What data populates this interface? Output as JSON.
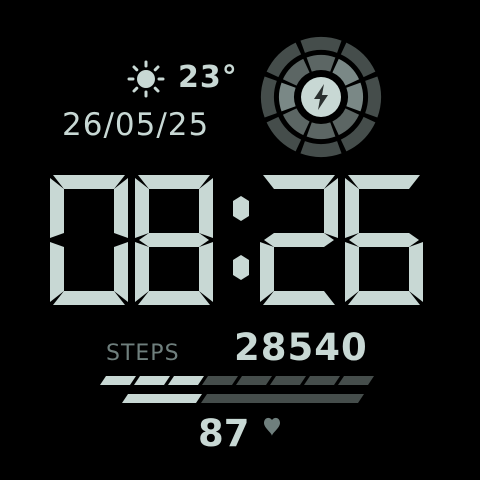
{
  "weather": {
    "temperature": "23°",
    "icon": "sun-icon"
  },
  "date": {
    "text": "26/05/25"
  },
  "time": {
    "digits": [
      "0",
      "8",
      "2",
      "6"
    ]
  },
  "steps": {
    "label": "STEPS",
    "value": "28540",
    "progress": 0.42,
    "bar_segments": 8
  },
  "heart_rate": {
    "value": "87",
    "icon": "heart-icon"
  },
  "battery": {
    "icon": "lightning-bolt-icon"
  },
  "colors": {
    "primary": "#c8d8d4",
    "dim": "#454d4b",
    "label": "#6f7f7d",
    "background": "#000000"
  }
}
